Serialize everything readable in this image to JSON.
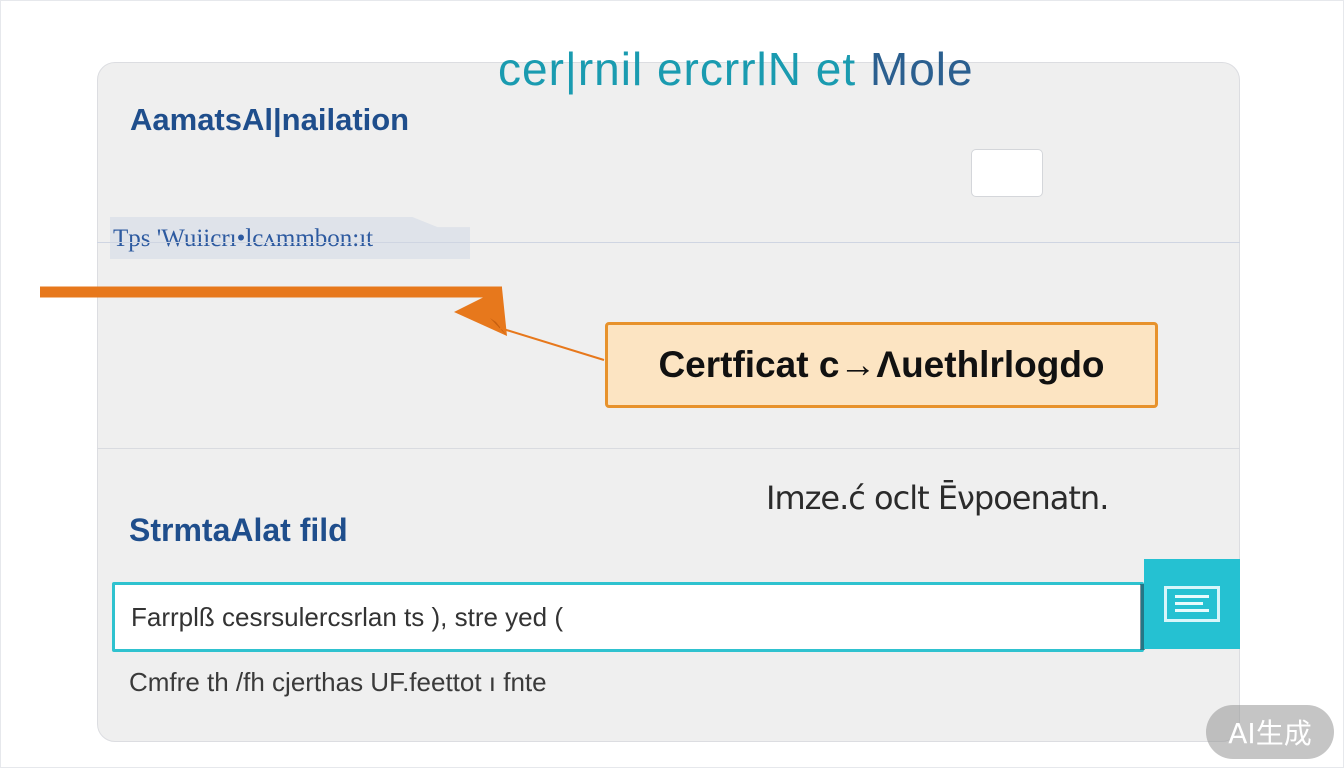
{
  "header": {
    "app_title": "cer|rnil ercrrlN et",
    "app_title_tail": "Mole"
  },
  "section": {
    "title": "AamatsAl|nailation"
  },
  "tab": {
    "label": "Tps 'Wuiicrı•lcʌmmbon:ıt"
  },
  "callout": {
    "label": "Certficat c→Λuethlrloɡdo"
  },
  "explanation": {
    "text": "Imze.ć oclt Ēνpoenatn."
  },
  "field": {
    "title": "StrmtaAlat fild",
    "input_value": "Farrplß cesrsulercsrlan ts ), stre yed (",
    "helper_text": "Cmfre th /fh cjerthas UF.feettot ı fnte"
  },
  "badge": {
    "label": "AI生成"
  },
  "colors": {
    "title_teal": "#1a9bb0",
    "heading_blue": "#1f4e8c",
    "callout_fill": "#fce4c2",
    "callout_border": "#e7922c",
    "arrow_orange": "#e7781c",
    "input_border": "#2fc2cf",
    "button_teal": "#25c1d2"
  },
  "icons": {
    "menu_button": "list-menu-icon",
    "annotation": "arrow-pointer-icon"
  }
}
